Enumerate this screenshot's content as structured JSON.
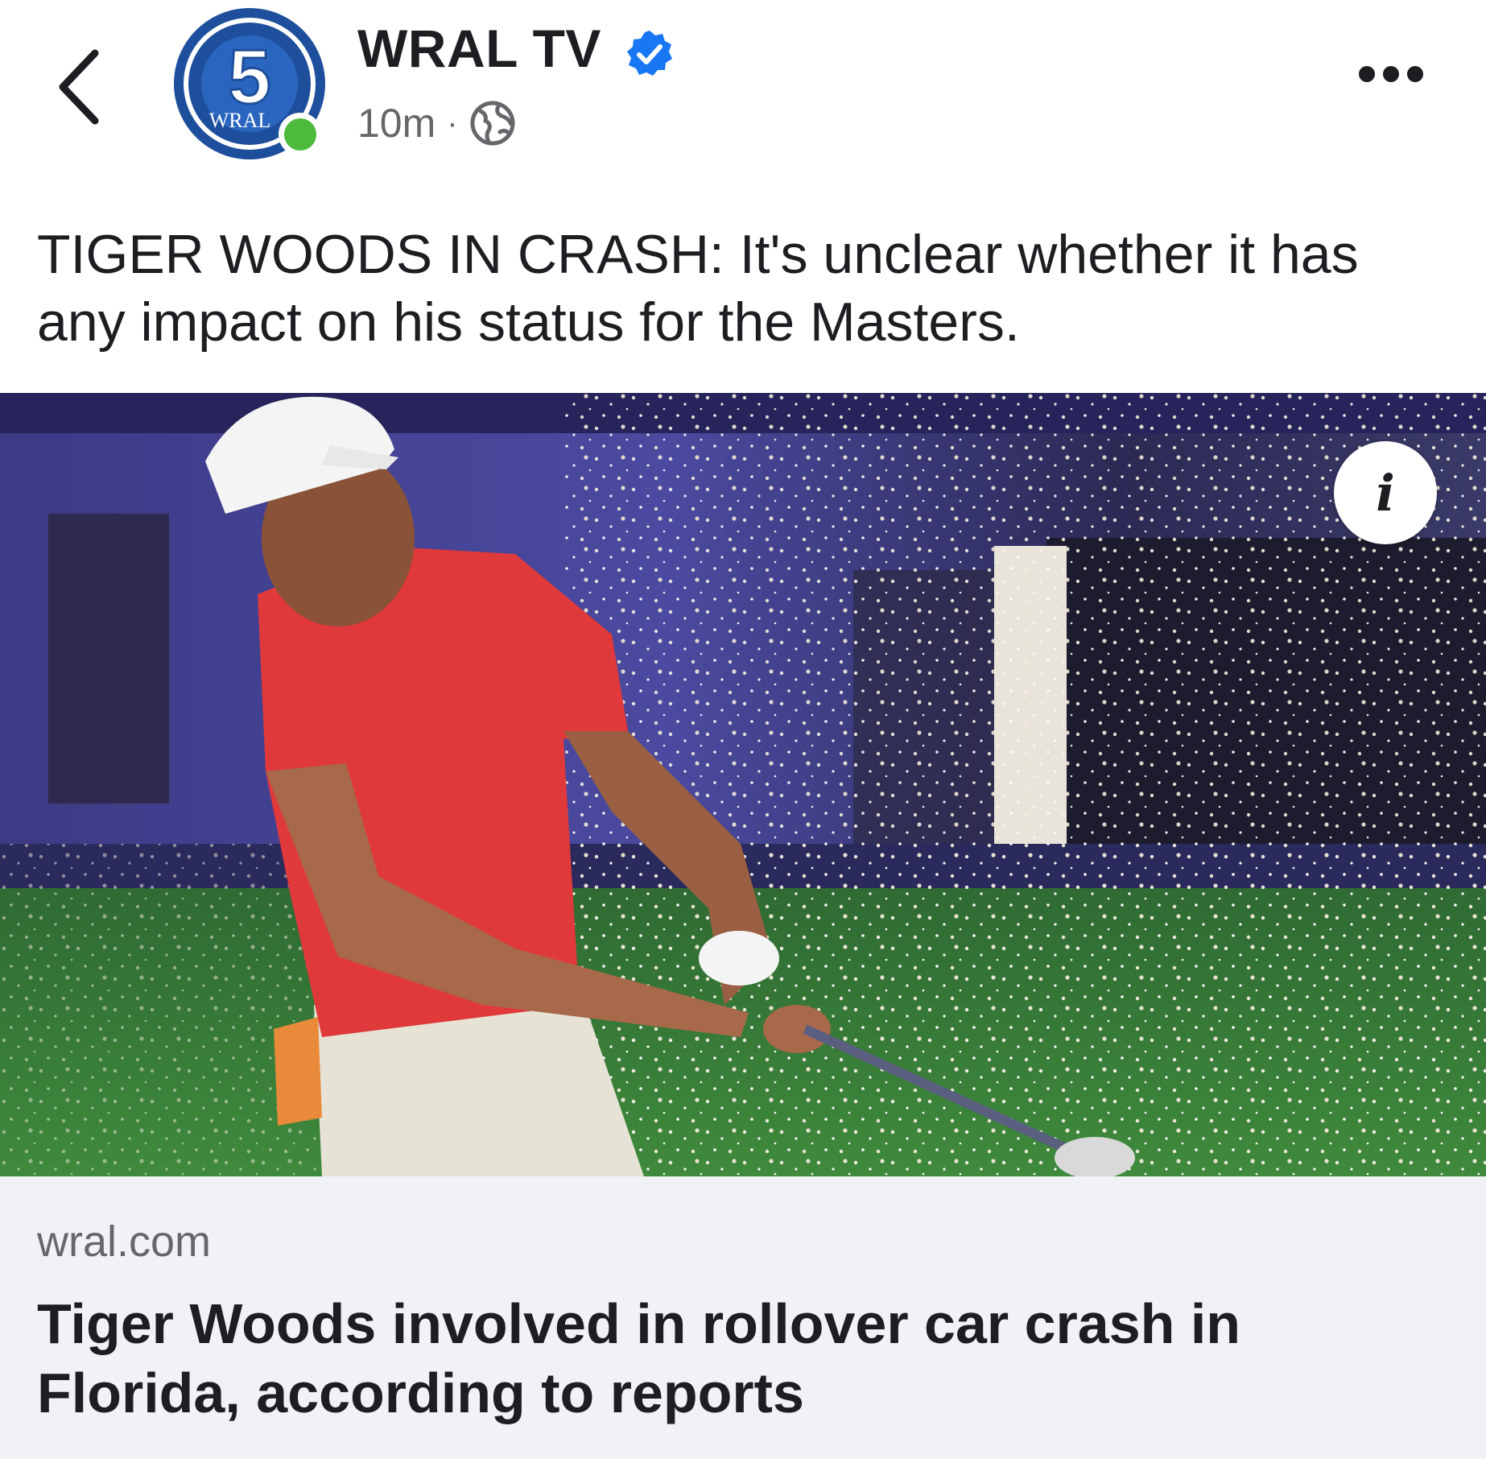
{
  "post": {
    "page_name": "WRAL TV",
    "verified": true,
    "time": "10m",
    "separator": "·",
    "audience_icon": "globe-icon",
    "avatar": {
      "number": "5",
      "text": "WRAL"
    },
    "caption": "TIGER WOODS IN CRASH: It's unclear whether it has any impact on his status for the Masters."
  },
  "image": {
    "info_label": "i"
  },
  "link": {
    "domain": "wral.com",
    "title": "Tiger Woods involved in rollover car crash in Florida, according to reports"
  },
  "colors": {
    "verified_blue": "#1877f2",
    "online_green": "#4cbb3b",
    "avatar_blue": "#1e4f9c",
    "card_bg": "#f0f2f5"
  }
}
